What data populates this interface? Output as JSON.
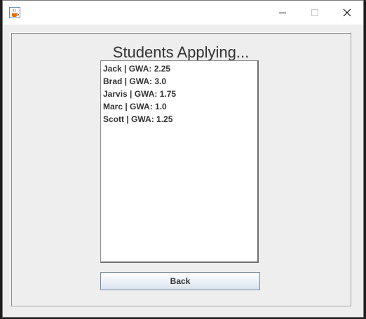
{
  "window": {
    "app_icon": "java-coffee-cup-icon",
    "controls": {
      "minimize_icon": "minimize-icon",
      "maximize_icon": "maximize-icon",
      "close_icon": "close-icon"
    }
  },
  "main": {
    "title": "Students Applying...",
    "students": [
      "Jack | GWA: 2.25",
      "Brad | GWA: 3.0",
      "Jarvis | GWA: 1.75",
      "Marc | GWA: 1.0",
      "Scott | GWA: 1.25"
    ],
    "back_label": "Back"
  },
  "colors": {
    "client_background": "#eeeeee",
    "text": "#333333",
    "button_border": "#7a8a99"
  }
}
